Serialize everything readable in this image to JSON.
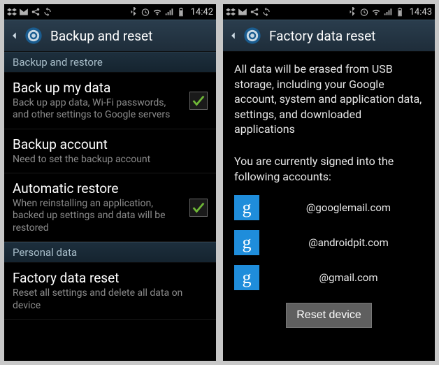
{
  "left": {
    "status": {
      "time": "14:42"
    },
    "title": "Backup and reset",
    "sections": [
      {
        "header": "Backup and restore",
        "items": [
          {
            "title": "Back up my data",
            "sub": "Back up app data, Wi-Fi passwords, and other settings to Google servers",
            "checkable": true,
            "checked": true
          },
          {
            "title": "Backup account",
            "sub": "Need to set the backup account",
            "checkable": false
          },
          {
            "title": "Automatic restore",
            "sub": "When reinstalling an application, backed up settings and data will be restored",
            "checkable": true,
            "checked": true
          }
        ]
      },
      {
        "header": "Personal data",
        "items": [
          {
            "title": "Factory data reset",
            "sub": "Reset all settings and delete all data on device",
            "checkable": false
          }
        ]
      }
    ]
  },
  "right": {
    "status": {
      "time": "14:43"
    },
    "title": "Factory data reset",
    "warning": "All data will be erased from USB storage, including your Google account, system and application data, settings, and downloaded applications",
    "signed_in_label": "You are currently signed into the following accounts:",
    "accounts": [
      {
        "email": "@googlemail.com"
      },
      {
        "email": "@androidpit.com"
      },
      {
        "email": "@gmail.com"
      }
    ],
    "g_letter": "g",
    "reset_button": "Reset device"
  }
}
